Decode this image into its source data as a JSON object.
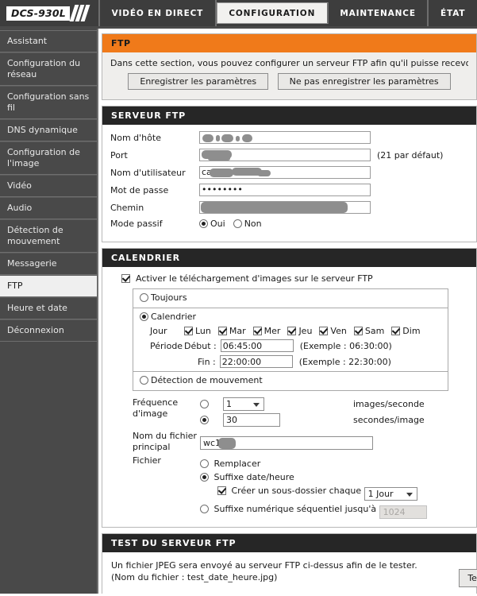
{
  "header": {
    "logo": "DCS-930L",
    "tabs": [
      {
        "label": "VIDÉO EN DIRECT",
        "active": false
      },
      {
        "label": "CONFIGURATION",
        "active": true
      },
      {
        "label": "MAINTENANCE",
        "active": false
      },
      {
        "label": "ÉTAT",
        "active": false
      }
    ]
  },
  "sidebar": {
    "items": [
      {
        "label": "Assistant",
        "active": false
      },
      {
        "label": "Configuration du réseau",
        "active": false
      },
      {
        "label": "Configuration sans fil",
        "active": false
      },
      {
        "label": "DNS dynamique",
        "active": false
      },
      {
        "label": "Configuration de l'image",
        "active": false
      },
      {
        "label": "Vidéo",
        "active": false
      },
      {
        "label": "Audio",
        "active": false
      },
      {
        "label": "Détection de mouvement",
        "active": false
      },
      {
        "label": "Messagerie",
        "active": false
      },
      {
        "label": "FTP",
        "active": true
      },
      {
        "label": "Heure et date",
        "active": false
      },
      {
        "label": "Déconnexion",
        "active": false
      }
    ]
  },
  "ftp_intro": {
    "title": "FTP",
    "description": "Dans cette section, vous pouvez configurer un serveur FTP afin qu'il puisse recevoir les imag",
    "save_label": "Enregistrer les paramètres",
    "cancel_label": "Ne pas enregistrer les paramètres"
  },
  "server": {
    "title": "SERVEUR FTP",
    "host_label": "Nom d'hôte",
    "host_value": "",
    "port_label": "Port",
    "port_value": "",
    "port_hint": "(21 par défaut)",
    "user_label": "Nom d'utilisateur",
    "user_value": "ca",
    "password_label": "Mot de passe",
    "password_value": "••••••••",
    "path_label": "Chemin",
    "path_value": "",
    "passive_label": "Mode passif",
    "passive_yes": "Oui",
    "passive_no": "Non",
    "passive_selected": "Oui"
  },
  "schedule": {
    "title": "CALENDRIER",
    "enable_label": "Activer le téléchargement d'images sur le serveur FTP",
    "enable_checked": true,
    "mode_always": "Toujours",
    "mode_schedule": "Calendrier",
    "mode_motion": "Détection de mouvement",
    "mode_selected": "Calendrier",
    "day_label": "Jour",
    "days": [
      {
        "label": "Lun",
        "checked": true
      },
      {
        "label": "Mar",
        "checked": true
      },
      {
        "label": "Mer",
        "checked": true
      },
      {
        "label": "Jeu",
        "checked": true
      },
      {
        "label": "Ven",
        "checked": true
      },
      {
        "label": "Sam",
        "checked": true
      },
      {
        "label": "Dim",
        "checked": true
      }
    ],
    "period_label": "Période",
    "start_label": "Début :",
    "start_value": "06:45:00",
    "start_example": "(Exemple : 06:30:00)",
    "end_label": "Fin :",
    "end_value": "22:00:00",
    "end_example": "(Exemple : 22:30:00)"
  },
  "frame": {
    "freq_label_line1": "Fréquence",
    "freq_label_line2": "d'image",
    "fps_value": "1",
    "fps_unit": "images/seconde",
    "spf_value": "30",
    "spf_unit": "secondes/image",
    "freq_selected": "secondes/image",
    "filename_label_line1": "Nom du fichier",
    "filename_label_line2": "principal",
    "filename_value": "wc1-",
    "file_label": "Fichier",
    "opt_replace": "Remplacer",
    "opt_datetime": "Suffixe date/heure",
    "opt_sequential": "Suffixe numérique séquentiel jusqu'à",
    "file_selected": "Suffixe date/heure",
    "subfolder_label": "Créer un sous-dossier chaque",
    "subfolder_checked": true,
    "subfolder_value": "1 Jour",
    "sequential_value": "1024"
  },
  "test": {
    "title": "TEST DU SERVEUR FTP",
    "line1": "Un fichier JPEG sera envoyé au serveur FTP ci-dessus afin de le tester.",
    "line2": "(Nom du fichier : test_date_heure.jpg)",
    "button_label": "Test"
  },
  "colors": {
    "accent_orange": "#f07a1a",
    "header_dark": "#3d3d3d",
    "sidebar": "#494949",
    "panel_dark": "#262626"
  }
}
